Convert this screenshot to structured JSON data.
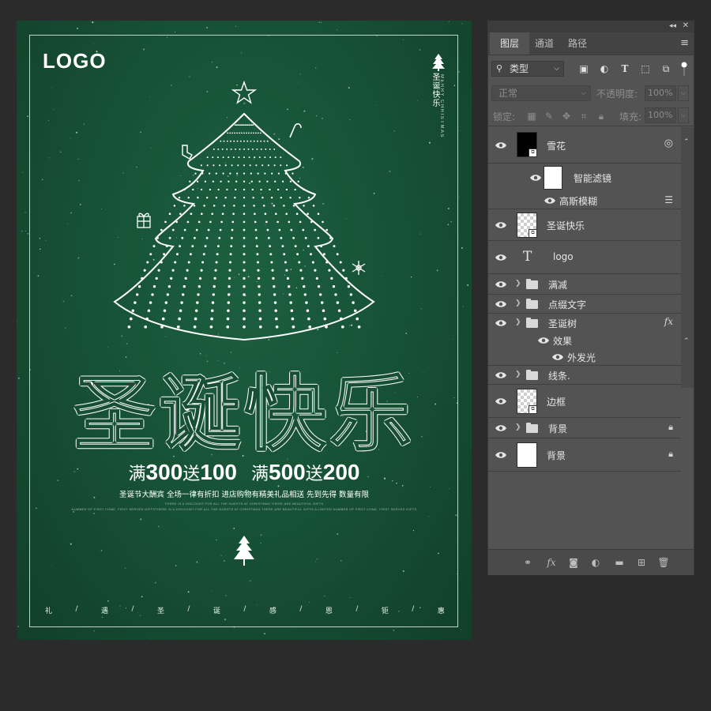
{
  "poster": {
    "logo": "LOGO",
    "vertical_title": "圣诞快乐",
    "vertical_subtitle": "MERRY CHRISTMAS",
    "headline": "圣诞快乐",
    "promo": {
      "full1_cn": "满",
      "full1_num": "300",
      "give1_cn": "送",
      "give1_num": "100",
      "full2_cn": "满",
      "full2_num": "500",
      "give2_cn": "送",
      "give2_num": "200"
    },
    "subline": "圣诞节大酬宾 全场一律有折扣 进店购物有精美礼品相送 先到先得 数量有限",
    "tiny_line1": "THERE IS A DISCOUNT FOR ALL THE GUESTS AT CHRISTMAS THERE ARE BEAUTIFUL GIFTS",
    "tiny_line2": "NUMBER OF FIRST COME, FIRST SERVED GIFTSTHERE IS A DISCOUNT FOR ALL THE GUESTS AT CHRISTMAS THERE ARE BEAUTIFUL GIFTS A LIMITED NUMBER OF FIRST COME, FIRST SERVED GIFTS",
    "bottom_row": [
      "礼",
      "/",
      "遇",
      "/",
      "圣",
      "/",
      "诞",
      "/",
      "感",
      "/",
      "恩",
      "/",
      "钜",
      "/",
      "惠"
    ],
    "colors": {
      "background": "#164f34",
      "text": "#ffffff"
    }
  },
  "panel": {
    "tabs": [
      {
        "label": "图层",
        "active": true
      },
      {
        "label": "通道",
        "active": false
      },
      {
        "label": "路径",
        "active": false
      }
    ],
    "filter": {
      "label": "类型"
    },
    "blend_mode": "正常",
    "opacity_label": "不透明度:",
    "opacity_value": "100%",
    "lock_label": "锁定:",
    "fill_label": "填充:",
    "fill_value": "100%",
    "layers": [
      {
        "name": "雪花",
        "thumb": "black",
        "visible": true
      },
      {
        "name": "智能滤镜",
        "thumb": "white",
        "visible": true
      },
      {
        "name": "高斯模糊",
        "visible": true
      },
      {
        "name": "圣诞快乐",
        "thumb": "checker",
        "visible": true
      },
      {
        "name": "logo",
        "thumb": "text",
        "visible": true
      },
      {
        "name": "满减",
        "thumb": "folder",
        "visible": true
      },
      {
        "name": "点缀文字",
        "thumb": "folder",
        "visible": true
      },
      {
        "name": "圣诞树",
        "thumb": "folder",
        "visible": true,
        "fx": "fx"
      },
      {
        "name": "效果",
        "visible": true
      },
      {
        "name": "外发光",
        "visible": true
      },
      {
        "name": "线条.",
        "thumb": "folder",
        "visible": true
      },
      {
        "name": "边框",
        "thumb": "checker",
        "visible": true
      },
      {
        "name": "背景",
        "thumb": "folder",
        "visible": true,
        "locked": true
      },
      {
        "name": "背景",
        "thumb": "white",
        "visible": true,
        "locked": true
      }
    ],
    "colors": {
      "panel_bg": "#535353",
      "text": "#e6e6e6",
      "tab_bar": "#434343"
    }
  }
}
